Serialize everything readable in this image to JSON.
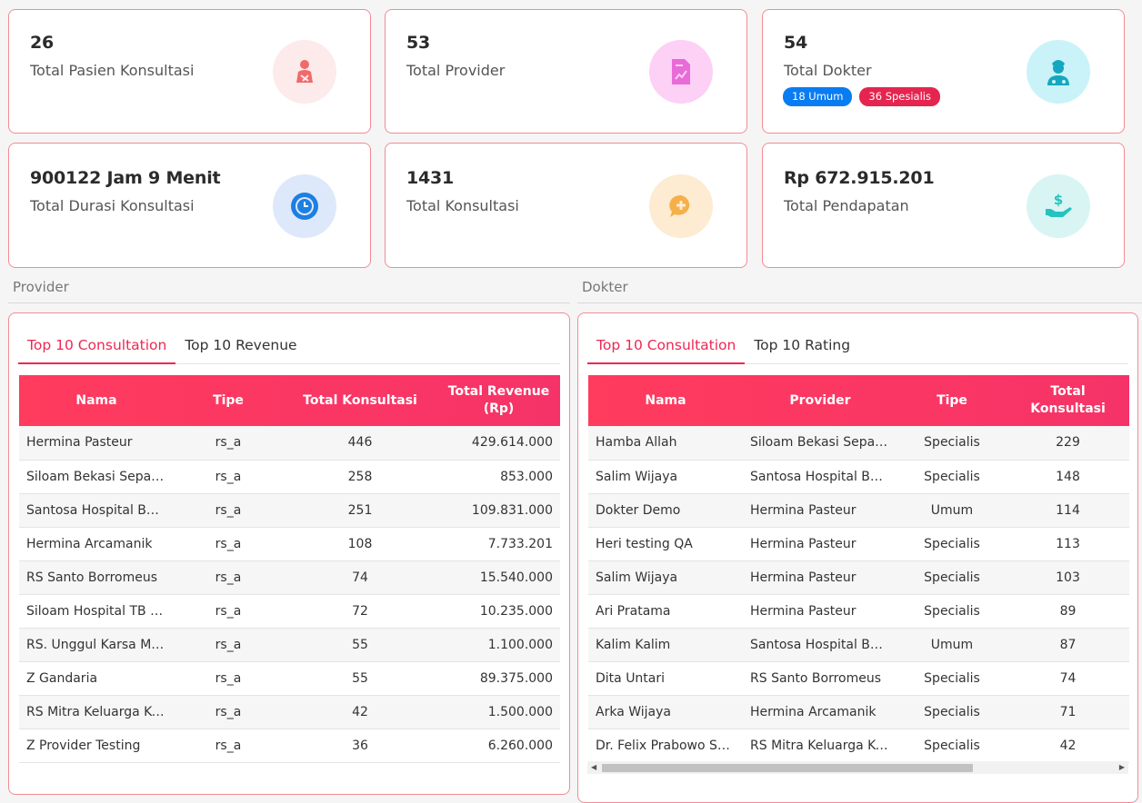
{
  "stats": [
    {
      "value": "26",
      "label": "Total Pasien Konsultasi",
      "icon": "patient-icon",
      "bg": "#fdeaea",
      "fg": "#ef6b6b"
    },
    {
      "value": "53",
      "label": "Total Provider",
      "icon": "document-chart-icon",
      "bg": "#fdd0f6",
      "fg": "#e86bd7"
    },
    {
      "value": "54",
      "label": "Total Dokter",
      "icon": "doctor-icon",
      "bg": "#c9f3f8",
      "fg": "#15a7bf"
    },
    {
      "value": "900122 Jam 9 Menit",
      "label": "Total Durasi Konsultasi",
      "icon": "clock-icon",
      "bg": "#dde9fb",
      "fg": "#1d7fe2"
    },
    {
      "value": "1431",
      "label": "Total Konsultasi",
      "icon": "chat-plus-icon",
      "bg": "#fdebd2",
      "fg": "#f5b04a"
    },
    {
      "value": "Rp 672.915.201",
      "label": "Total Pendapatan",
      "icon": "money-hand-icon",
      "bg": "#d8f5f4",
      "fg": "#25c3bd"
    }
  ],
  "doctor_badges": {
    "umum": "18 Umum",
    "spesialis": "36 Spesialis",
    "umum_color": "#0a7cf2",
    "spesialis_color": "#e5254f"
  },
  "provider_section": {
    "title": "Provider",
    "tabs": [
      "Top 10 Consultation",
      "Top 10 Revenue"
    ],
    "columns": [
      "Nama",
      "Tipe",
      "Total Konsultasi",
      "Total Revenue (Rp)"
    ],
    "rows": [
      [
        "Hermina Pasteur",
        "rs_a",
        "446",
        "429.614.000"
      ],
      [
        "Siloam Bekasi Sepanj...",
        "rs_a",
        "258",
        "853.000"
      ],
      [
        "Santosa Hospital Ban...",
        "rs_a",
        "251",
        "109.831.000"
      ],
      [
        "Hermina Arcamanik",
        "rs_a",
        "108",
        "7.733.201"
      ],
      [
        "RS Santo Borromeus",
        "rs_a",
        "74",
        "15.540.000"
      ],
      [
        "Siloam Hospital TB Si...",
        "rs_a",
        "72",
        "10.235.000"
      ],
      [
        "RS. Unggul Karsa Med...",
        "rs_a",
        "55",
        "1.100.000"
      ],
      [
        "Z Gandaria",
        "rs_a",
        "55",
        "89.375.000"
      ],
      [
        "RS Mitra Keluarga Kel...",
        "rs_a",
        "42",
        "1.500.000"
      ],
      [
        "Z Provider Testing",
        "rs_a",
        "36",
        "6.260.000"
      ]
    ]
  },
  "doctor_section": {
    "title": "Dokter",
    "tabs": [
      "Top 10 Consultation",
      "Top 10 Rating"
    ],
    "columns": [
      "Nama",
      "Provider",
      "Tipe",
      "Total Konsultasi"
    ],
    "rows": [
      [
        "Hamba Allah",
        "Siloam Bekasi Sepanj...",
        "Specialis",
        "229"
      ],
      [
        "Salim Wijaya",
        "Santosa Hospital Ban...",
        "Specialis",
        "148"
      ],
      [
        "Dokter Demo",
        "Hermina Pasteur",
        "Umum",
        "114"
      ],
      [
        "Heri testing QA",
        "Hermina Pasteur",
        "Specialis",
        "113"
      ],
      [
        "Salim Wijaya",
        "Hermina Pasteur",
        "Specialis",
        "103"
      ],
      [
        "Ari Pratama",
        "Hermina Pasteur",
        "Specialis",
        "89"
      ],
      [
        "Kalim Kalim",
        "Santosa Hospital Ban...",
        "Umum",
        "87"
      ],
      [
        "Dita Untari",
        "RS Santo Borromeus",
        "Specialis",
        "74"
      ],
      [
        "Arka Wijaya",
        "Hermina Arcamanik",
        "Specialis",
        "71"
      ],
      [
        "Dr. Felix Prabowo Sali...",
        "RS Mitra Keluarga Kel...",
        "Specialis",
        "42"
      ]
    ]
  },
  "accent_color": "#ee2752"
}
